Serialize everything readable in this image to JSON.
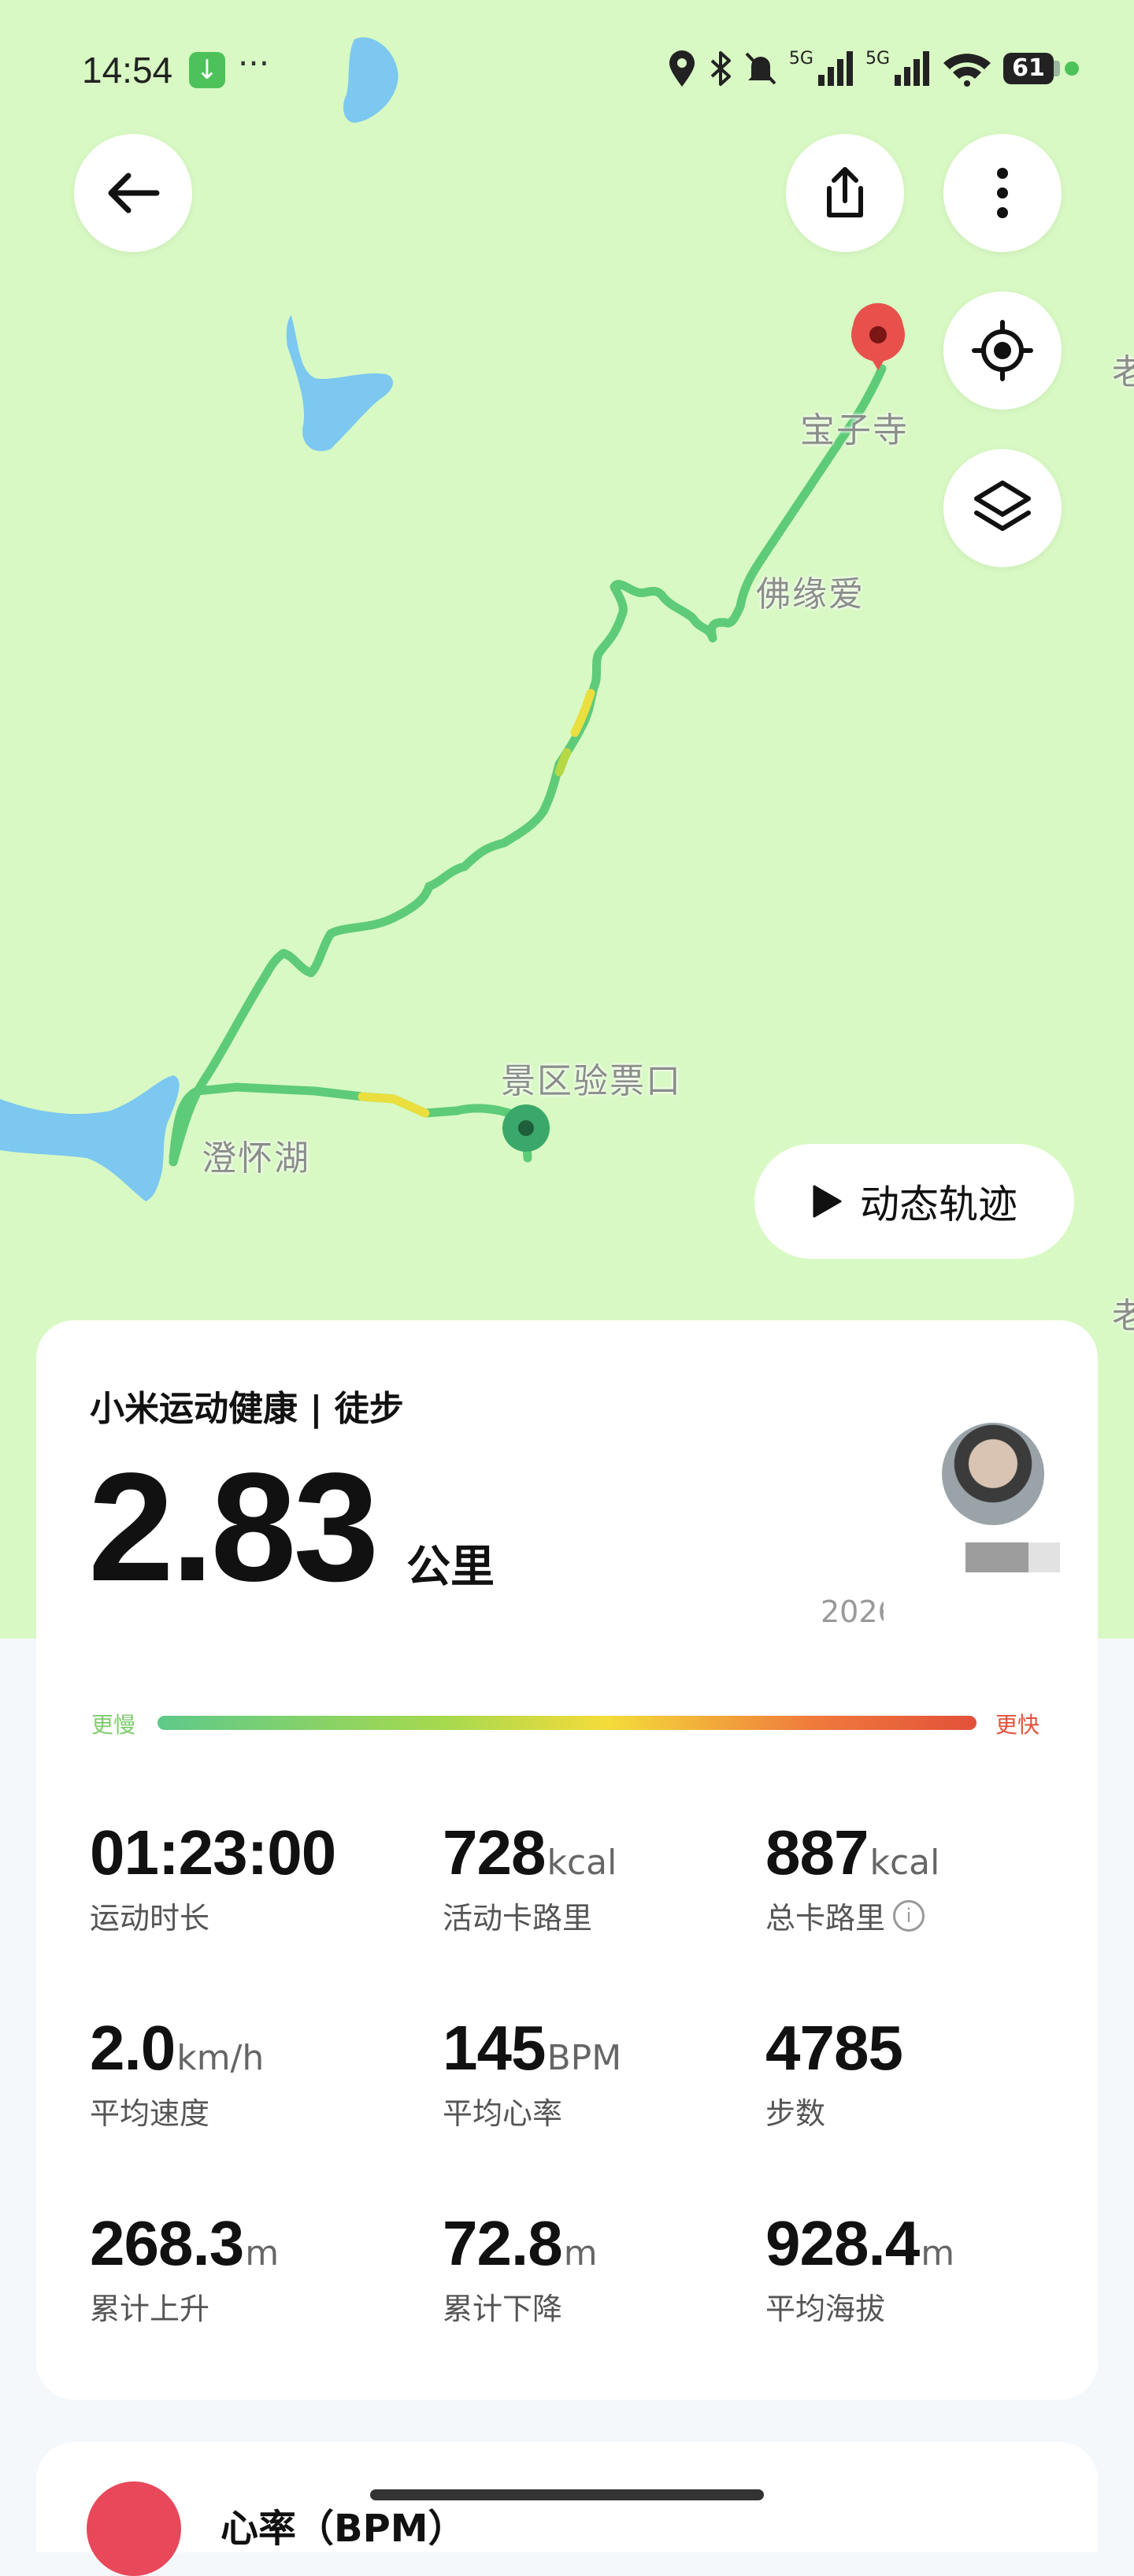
{
  "status_bar": {
    "time": "14:54",
    "more": "···",
    "network": "5G",
    "battery": "61"
  },
  "map": {
    "labels": {
      "temple": "宝子寺",
      "foyuan": "佛缘爱",
      "ticket_gate": "景区验票口",
      "lake": "澄怀湖",
      "edge_top": "老",
      "edge_bottom": "老"
    },
    "replay_label": "动态轨迹",
    "colors": {
      "land": "#d8f9c3",
      "water": "#7cc8f0",
      "track": "#5ecb78",
      "track_fast": "#eadf3e",
      "end_pin": "#e8504c",
      "start_pin": "#3aa86a"
    }
  },
  "summary": {
    "app_activity": "小米运动健康 | 徒步",
    "distance": "2.83",
    "distance_unit": "公里",
    "date_partial": "2026",
    "pace_slow": "更慢",
    "pace_fast": "更快",
    "stats": [
      {
        "value": "01:23:00",
        "unit": "",
        "label": "运动时长"
      },
      {
        "value": "728",
        "unit": "kcal",
        "label": "活动卡路里"
      },
      {
        "value": "887",
        "unit": "kcal",
        "label": "总卡路里"
      },
      {
        "value": "2.0",
        "unit": "km/h",
        "label": "平均速度"
      },
      {
        "value": "145",
        "unit": "BPM",
        "label": "平均心率"
      },
      {
        "value": "4785",
        "unit": "",
        "label": "步数"
      },
      {
        "value": "268.3",
        "unit": "m",
        "label": "累计上升"
      },
      {
        "value": "72.8",
        "unit": "m",
        "label": "累计下降"
      },
      {
        "value": "928.4",
        "unit": "m",
        "label": "平均海拔"
      }
    ]
  },
  "heart_section": {
    "title": "心率（BPM）"
  }
}
